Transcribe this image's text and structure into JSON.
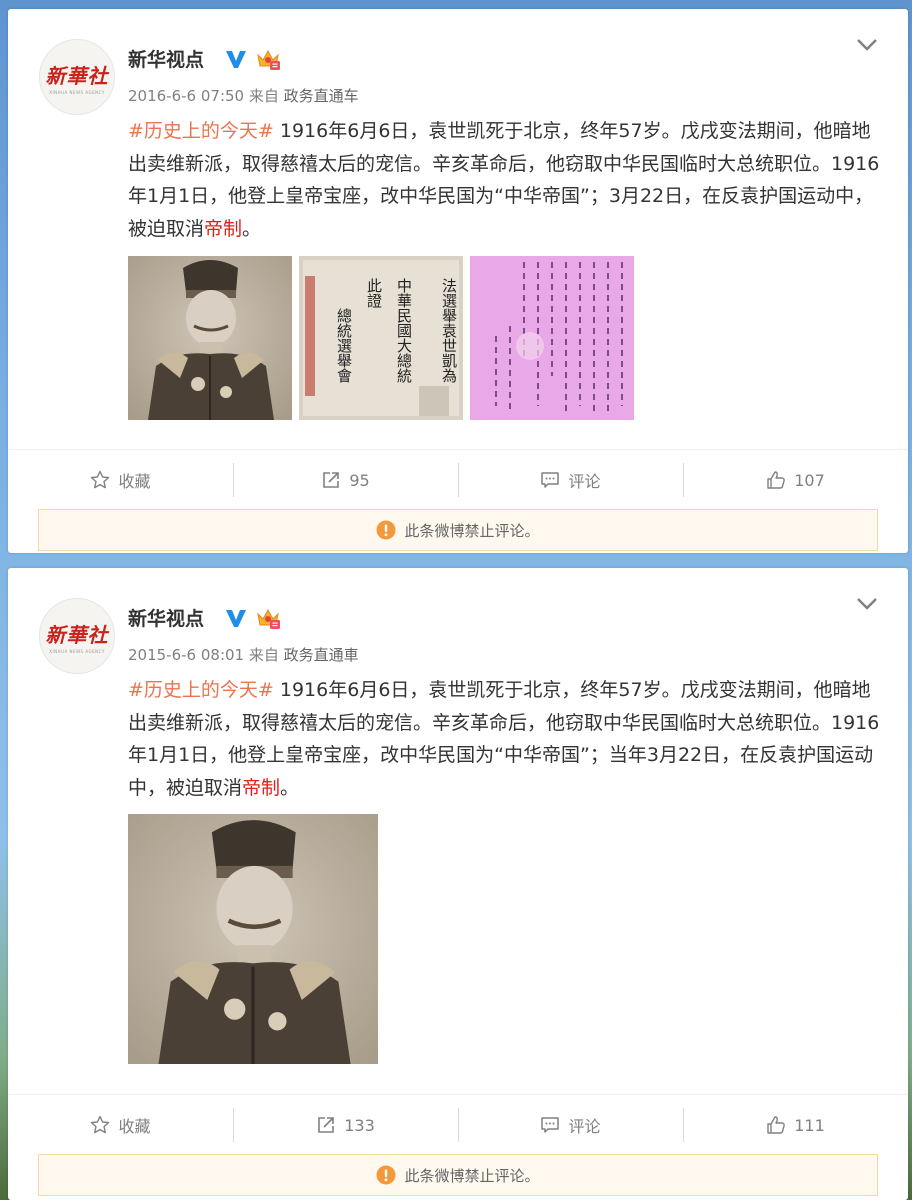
{
  "posts": [
    {
      "author": "新华视点",
      "avatar_text": "新華社",
      "avatar_sub": "XINHUA NEWS AGENCY",
      "time": "2016-6-6 07:50",
      "source_prefix": "来自",
      "source": "政务直通车",
      "body": {
        "hashtag": "#历史上的今天#",
        "text": " 1916年6月6日，袁世凯死于北京，终年57岁。戊戌变法期间，他暗地出卖维新派，取得慈禧太后的宠信。辛亥革命后，他窃取中华民国临时大总统职位。1916年1月1日，他登上皇帝宝座，改中华民国为“中华帝国”；3月22日，在反袁护国运动中，被迫取消",
        "highlight": "帝制",
        "end": "。"
      },
      "actions": {
        "favorite": "收藏",
        "repost": "95",
        "comment": "评论",
        "like": "107"
      },
      "notice": "此条微博禁止评论。"
    },
    {
      "author": "新华视点",
      "avatar_text": "新華社",
      "avatar_sub": "XINHUA NEWS AGENCY",
      "time": "2015-6-6 08:01",
      "source_prefix": "来自",
      "source": "政务直通車",
      "body": {
        "hashtag": "#历史上的今天#",
        "text": " 1916年6月6日，袁世凯死于北京，终年57岁。戊戌变法期间，他暗地出卖维新派，取得慈禧太后的宠信。辛亥革命后，他窃取中华民国临时大总统职位。1916年1月1日，他登上皇帝宝座，改中华民国为“中华帝国”；当年3月22日，在反袁护国运动中，被迫取消",
        "highlight": "帝制",
        "end": "。"
      },
      "actions": {
        "favorite": "收藏",
        "repost": "133",
        "comment": "评论",
        "like": "111"
      },
      "notice": "此条微博禁止评论。"
    }
  ],
  "document_image": {
    "cols": [
      "法選舉袁世凱為",
      "中華民國大總統",
      "此證",
      "總統選舉會"
    ]
  },
  "colors": {
    "hashtag": "#eb7350",
    "highlight": "#e0201a",
    "verify": "#1e8ee8",
    "notice_icon": "#f29a3b",
    "notice_bg": "#fef8ee"
  },
  "icons": [
    "chevron-down-icon",
    "star-icon",
    "share-icon",
    "comment-icon",
    "thumb-up-icon",
    "warning-icon",
    "verified-icon",
    "vip-crown-icon"
  ]
}
